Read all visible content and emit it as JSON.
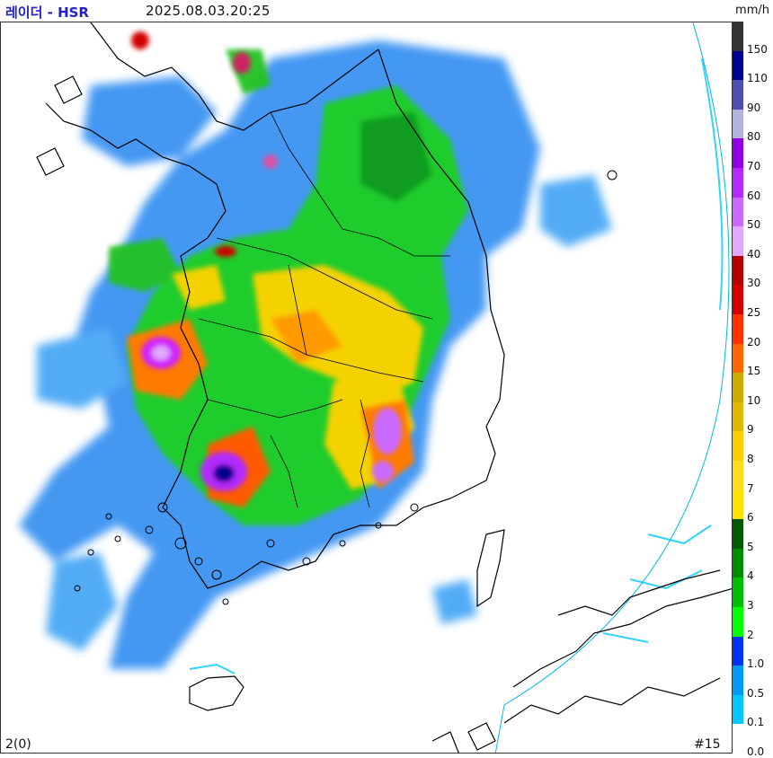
{
  "header": {
    "title": "레이더 - HSR",
    "timestamp": "2025.08.03.20:25",
    "unit": "mm/h"
  },
  "legend": {
    "levels": [
      {
        "label": "150",
        "color": "#333333"
      },
      {
        "label": "110",
        "color": "#000390"
      },
      {
        "label": "90",
        "color": "#4c4eb1"
      },
      {
        "label": "80",
        "color": "#b3b4de"
      },
      {
        "label": "70",
        "color": "#9300e4"
      },
      {
        "label": "60",
        "color": "#b329ff"
      },
      {
        "label": "50",
        "color": "#c969ff"
      },
      {
        "label": "40",
        "color": "#e0a9ff"
      },
      {
        "label": "30",
        "color": "#b40000"
      },
      {
        "label": "25",
        "color": "#d20000"
      },
      {
        "label": "20",
        "color": "#ff3200"
      },
      {
        "label": "15",
        "color": "#ff6600"
      },
      {
        "label": "10",
        "color": "#ccaa00"
      },
      {
        "label": "9",
        "color": "#e0b900"
      },
      {
        "label": "8",
        "color": "#f9cd00"
      },
      {
        "label": "7",
        "color": "#ffdc1f"
      },
      {
        "label": "6",
        "color": "#ffe100"
      },
      {
        "label": "5",
        "color": "#005a00"
      },
      {
        "label": "4",
        "color": "#008c00"
      },
      {
        "label": "3",
        "color": "#00be00"
      },
      {
        "label": "2",
        "color": "#00ff00"
      },
      {
        "label": "1.0",
        "color": "#0033f5"
      },
      {
        "label": "0.5",
        "color": "#009bf5"
      },
      {
        "label": "0.1",
        "color": "#00c8ff"
      },
      {
        "label": "0.0",
        "color": "#ffffff"
      }
    ]
  },
  "footer": {
    "left": "2(0)",
    "right": "#15"
  }
}
